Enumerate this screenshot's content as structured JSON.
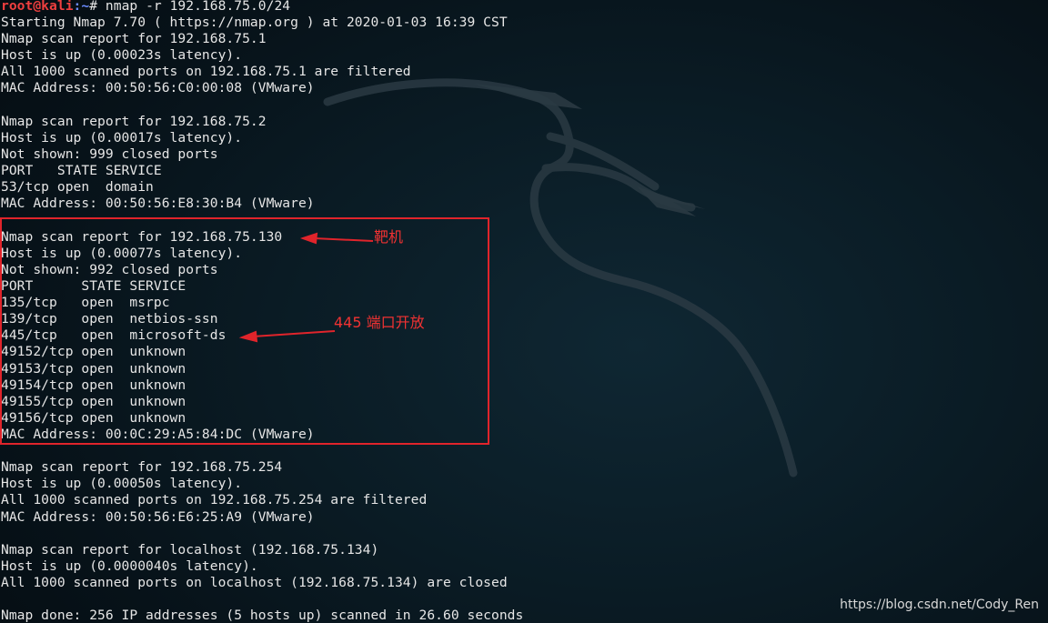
{
  "prompt": {
    "user": "root@kali",
    "path": ":~",
    "symbol": "# ",
    "command": "nmap -r 192.168.75.0/24"
  },
  "output_lines": [
    "Starting Nmap 7.70 ( https://nmap.org ) at 2020-01-03 16:39 CST",
    "Nmap scan report for 192.168.75.1",
    "Host is up (0.00023s latency).",
    "All 1000 scanned ports on 192.168.75.1 are filtered",
    "MAC Address: 00:50:56:C0:00:08 (VMware)",
    "",
    "Nmap scan report for 192.168.75.2",
    "Host is up (0.00017s latency).",
    "Not shown: 999 closed ports",
    "PORT   STATE SERVICE",
    "53/tcp open  domain",
    "MAC Address: 00:50:56:E8:30:B4 (VMware)",
    "",
    "Nmap scan report for 192.168.75.130",
    "Host is up (0.00077s latency).",
    "Not shown: 992 closed ports",
    "PORT      STATE SERVICE",
    "135/tcp   open  msrpc",
    "139/tcp   open  netbios-ssn",
    "445/tcp   open  microsoft-ds",
    "49152/tcp open  unknown",
    "49153/tcp open  unknown",
    "49154/tcp open  unknown",
    "49155/tcp open  unknown",
    "49156/tcp open  unknown",
    "MAC Address: 00:0C:29:A5:84:DC (VMware)",
    "",
    "Nmap scan report for 192.168.75.254",
    "Host is up (0.00050s latency).",
    "All 1000 scanned ports on 192.168.75.254 are filtered",
    "MAC Address: 00:50:56:E6:25:A9 (VMware)",
    "",
    "Nmap scan report for localhost (192.168.75.134)",
    "Host is up (0.0000040s latency).",
    "All 1000 scanned ports on localhost (192.168.75.134) are closed",
    "",
    "Nmap done: 256 IP addresses (5 hosts up) scanned in 26.60 seconds"
  ],
  "annotations": {
    "target_label": "靶机",
    "port_label": "445 端口开放"
  },
  "watermark": "https://blog.csdn.net/Cody_Ren",
  "colors": {
    "prompt_user": "#ef3f3f",
    "prompt_path": "#6b8cff",
    "annotation": "#f03232",
    "text": "#e6e6e6"
  }
}
